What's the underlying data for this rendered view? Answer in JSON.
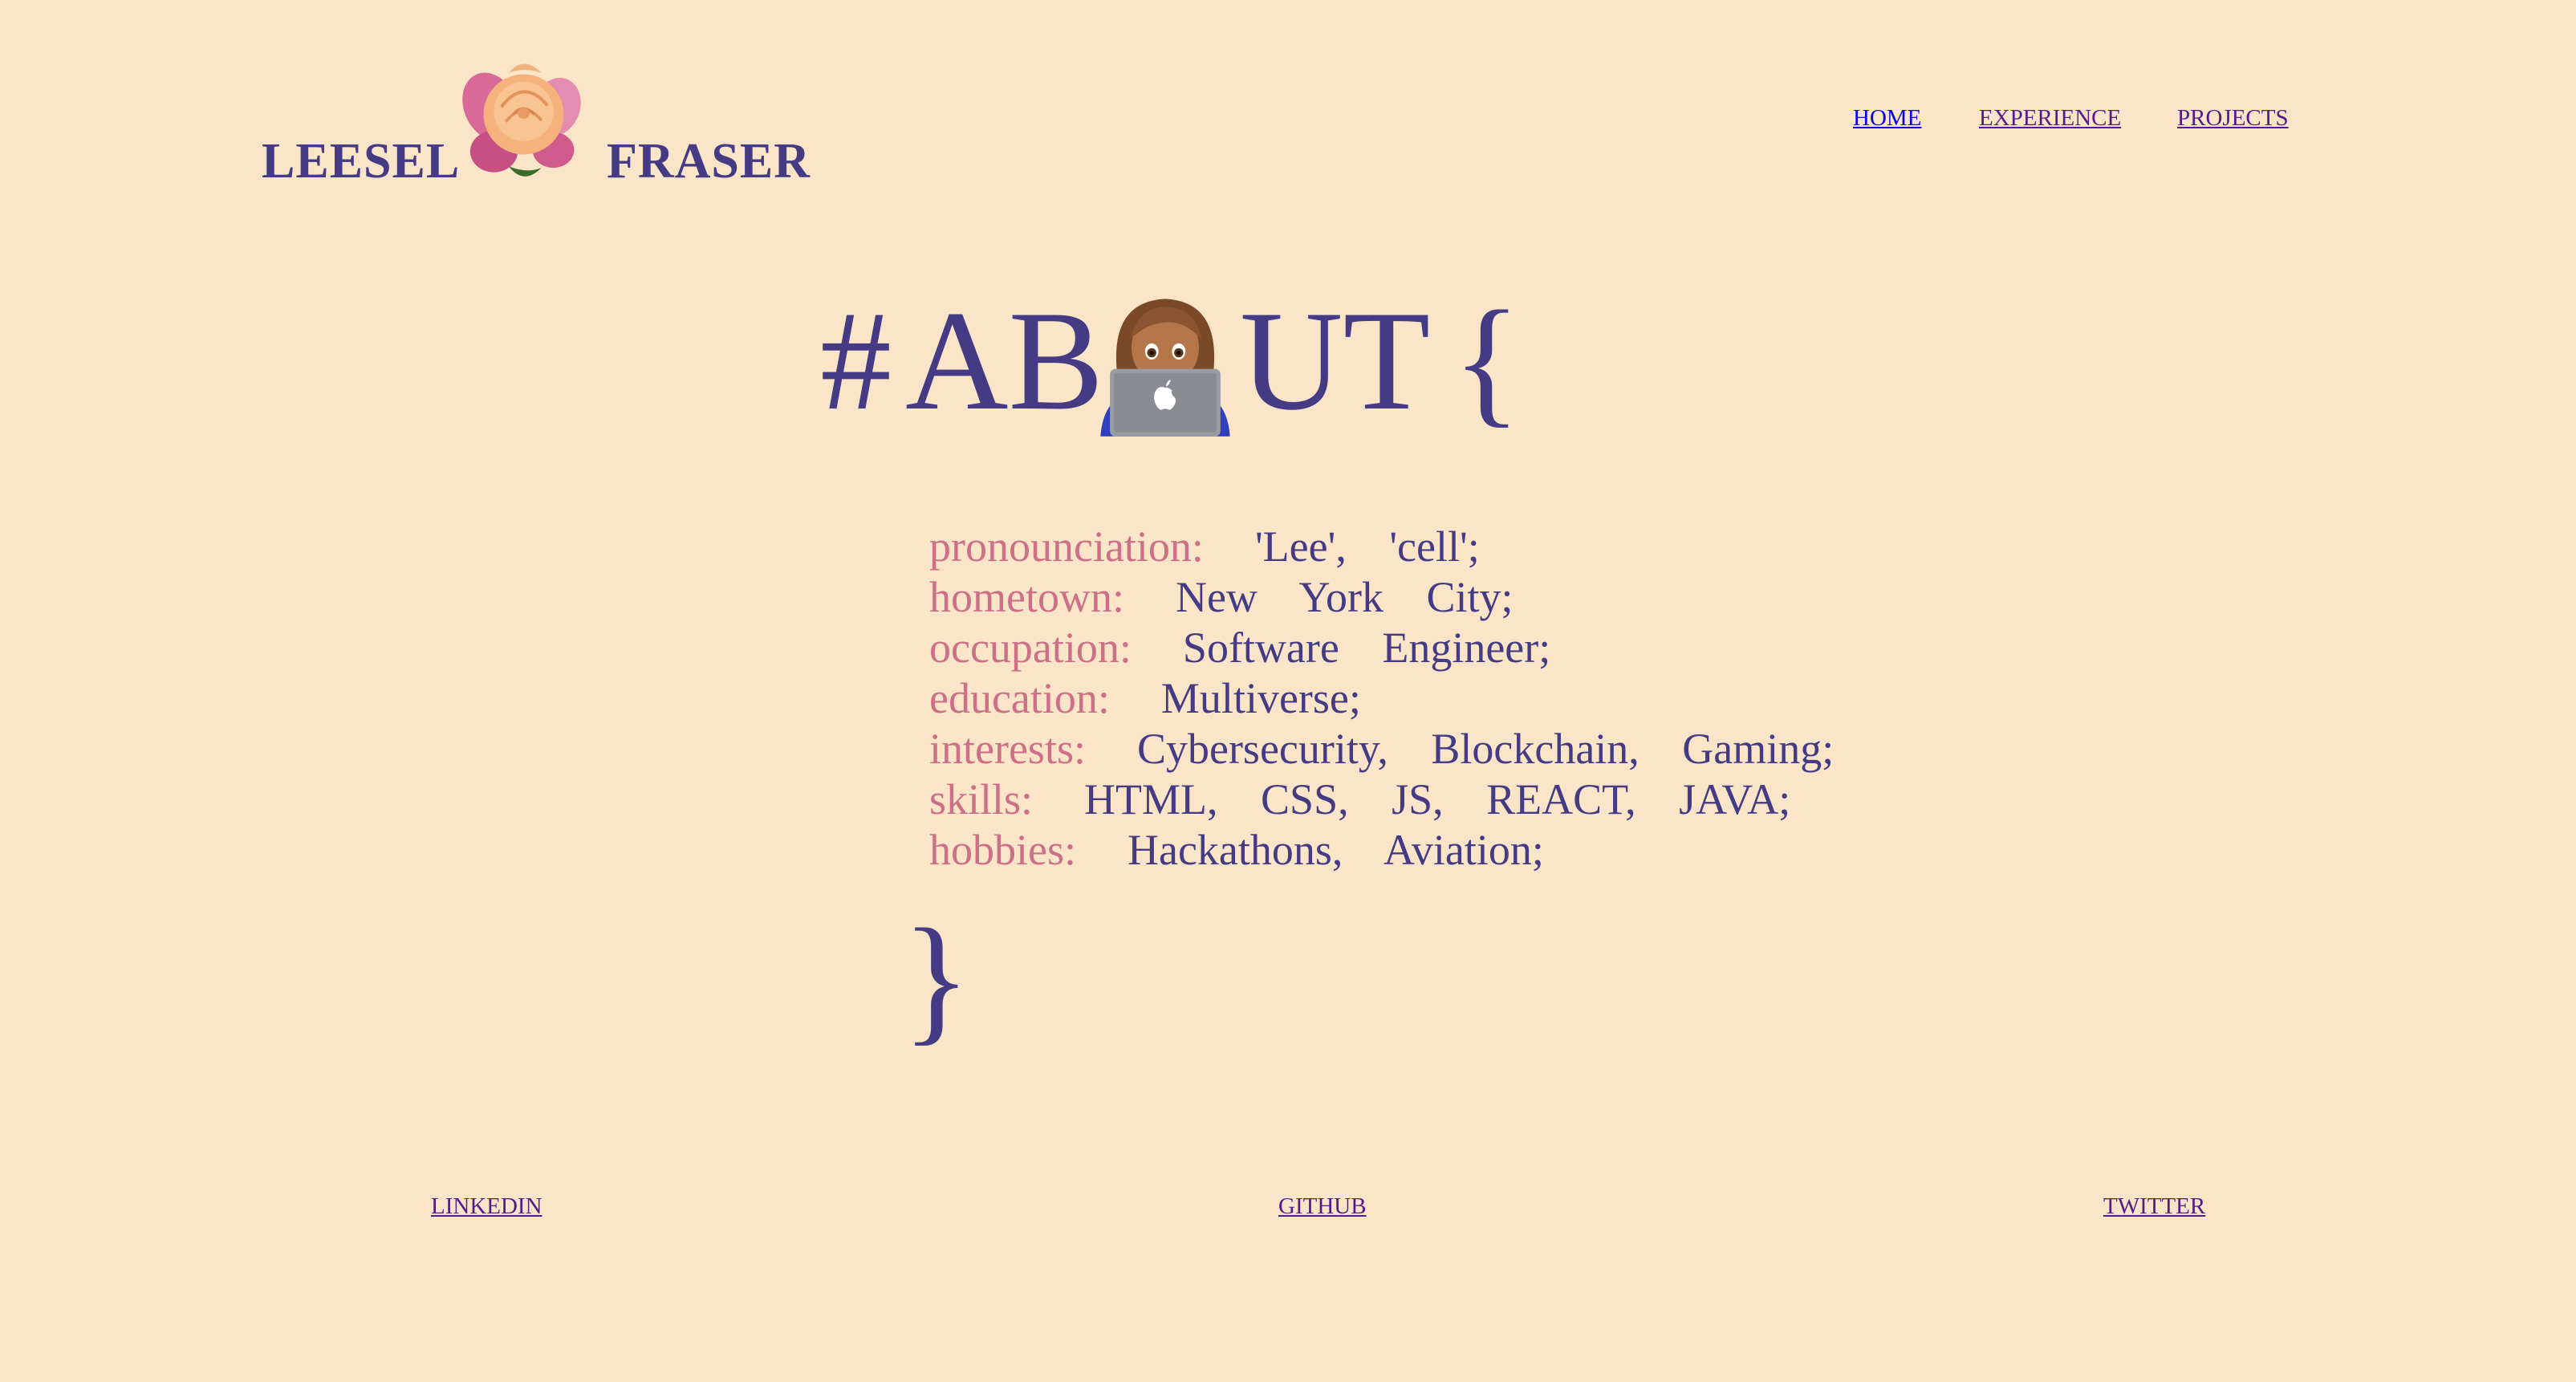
{
  "logo": {
    "first_name": "LEESEL",
    "last_name": "FRASER",
    "icon": "rose-icon"
  },
  "nav": {
    "home": "HOME",
    "experience": "EXPERIENCE",
    "projects": "PROJECTS"
  },
  "about": {
    "hash": "#",
    "ab": "AB",
    "ut": "UT",
    "open_brace": "{",
    "emoji": "woman-technologist-icon",
    "close_brace": "}"
  },
  "details": [
    {
      "key": "pronounciation:",
      "value": "'Lee', 'cell';"
    },
    {
      "key": "hometown:",
      "value": "New York City;"
    },
    {
      "key": "occupation:",
      "value": "Software Engineer;"
    },
    {
      "key": "education:",
      "value": "Multiverse;"
    },
    {
      "key": "interests:",
      "value": "Cybersecurity, Blockchain, Gaming;"
    },
    {
      "key": "skills:",
      "value": "HTML, CSS, JS, REACT, JAVA;"
    },
    {
      "key": "hobbies:",
      "value": "Hackathons, Aviation;"
    }
  ],
  "footer": {
    "linkedin": "LINKEDIN",
    "github": "GITHUB",
    "twitter": "TWITTER"
  },
  "colors": {
    "background": "#fbe5c8",
    "primary": "#453b85",
    "key": "#cd6f86",
    "link_active": "#0a00ee",
    "link_visited": "#551a8b"
  }
}
